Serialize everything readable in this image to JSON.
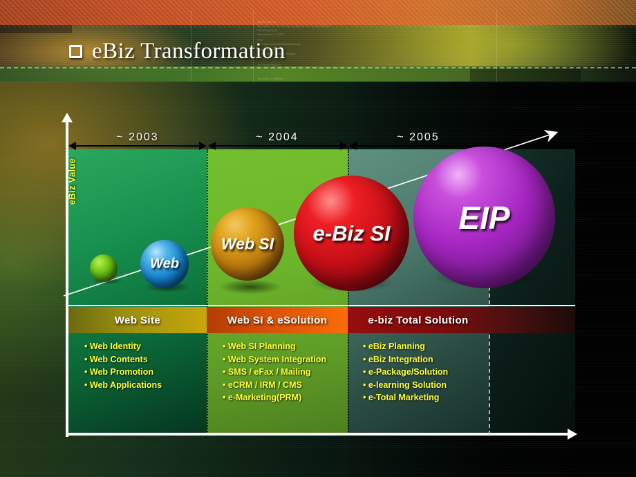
{
  "slide": {
    "title": "eBiz Transformation",
    "bullet_icon": "square-bullet-icon"
  },
  "chart": {
    "y_axis_label": "eBiz Value",
    "timeline": [
      {
        "label": "~ 2003"
      },
      {
        "label": "~ 2004"
      },
      {
        "label": "~ 2005"
      }
    ],
    "spheres": [
      {
        "label": "",
        "color": "#6cc016",
        "name": "sphere-seed"
      },
      {
        "label": "Web",
        "color": "#1f9fe0",
        "name": "sphere-web"
      },
      {
        "label": "Web SI",
        "color": "#d99512",
        "name": "sphere-web-si"
      },
      {
        "label": "e-Biz SI",
        "color": "#d6111b",
        "name": "sphere-ebiz-si"
      },
      {
        "label": "EIP",
        "color": "#a627c4",
        "name": "sphere-eip"
      }
    ],
    "stages": [
      {
        "header": "Web Site",
        "header_color": "#c8a70a",
        "panel_color": "#18924f",
        "items": [
          "Web Identity",
          "Web Contents",
          "Web Promotion",
          "Web Applications"
        ]
      },
      {
        "header": "Web SI & eSolution",
        "header_color": "#f96d08",
        "panel_color": "#6cb62b",
        "items": [
          "Web SI Planning",
          "Web System Integration",
          "SMS / eFax / Mailing",
          "eCRM / IRM / CMS",
          "e-Marketing(PRM)"
        ]
      },
      {
        "header": "e-biz Total Solution",
        "header_color": "#960d0d",
        "panel_color": "#4b7a6c",
        "items": [
          "eBiz Planning",
          "eBiz Integration",
          "e-Package/Solution",
          "e-learning Solution",
          "e-Total Marketing"
        ]
      }
    ],
    "bullet_char": "•",
    "growth_arrow": "diagonal-growth-arrow"
  },
  "colors": {
    "accent_yellow": "#ffff33",
    "axis_white": "#ffffff",
    "background_dark": "#030a07"
  }
}
